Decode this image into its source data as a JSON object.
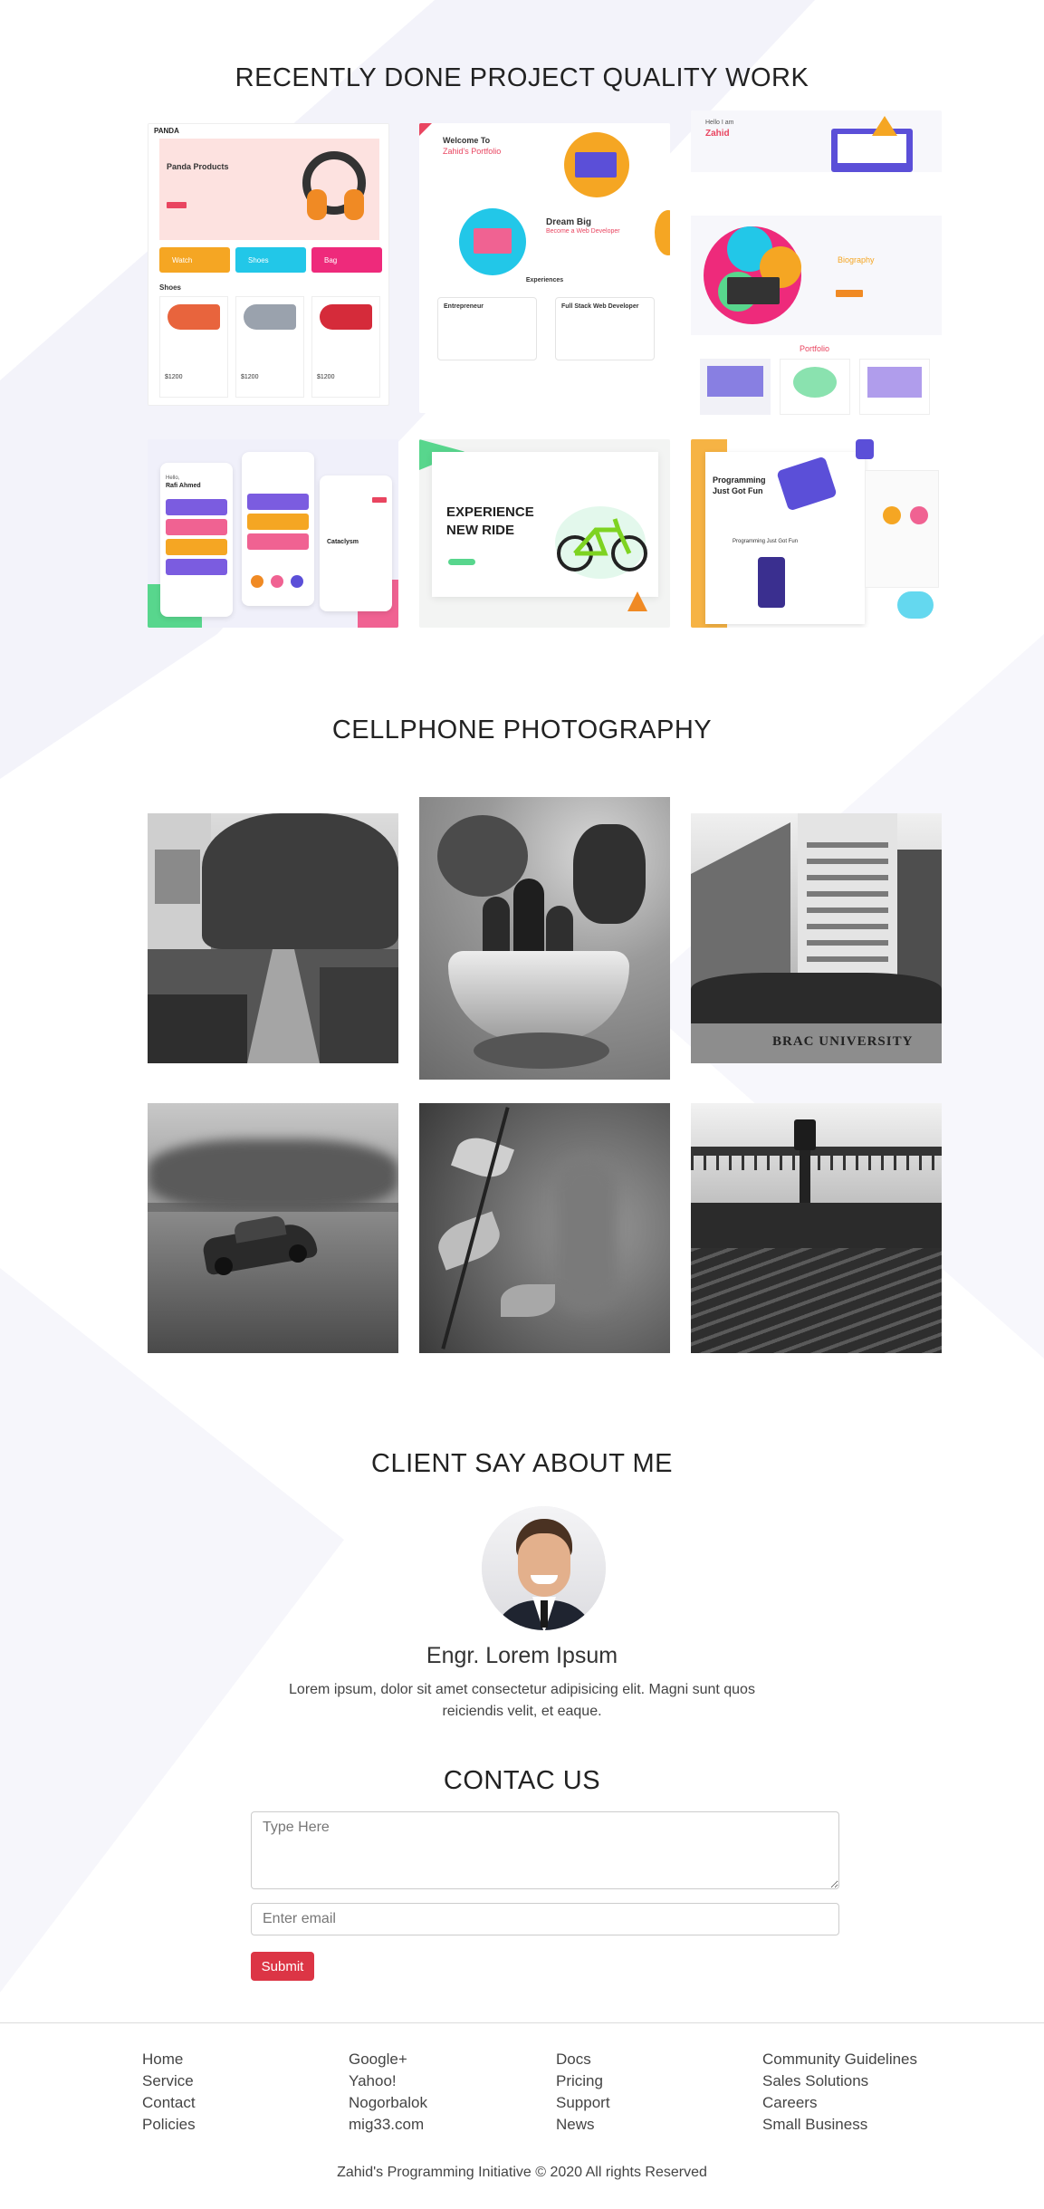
{
  "sections": {
    "projects_title": "RECENTLY DONE PROJECT QUALITY WORK",
    "photography_title": "CELLPHONE PHOTOGRAPHY",
    "client_title": "CLIENT SAY ABOUT ME",
    "contact_title": "CONTAC US"
  },
  "projects": [
    {
      "title": "Panda Products",
      "brand": "PANDA",
      "tiles": [
        "Watch",
        "Shoes",
        "Bag"
      ],
      "section": "Shoes",
      "price": "$1200"
    },
    {
      "title": "Welcome To",
      "subtitle": "Zahid's Portfolio",
      "heading": "Dream Big",
      "sub": "Become a Web Developer",
      "exp": "Experiences",
      "left": "Entrepreneur",
      "right": "Full Stack Web Developer"
    },
    {
      "greeting": "Hello I am",
      "name": "Zahid",
      "bio": "Biography",
      "portfolio": "Portfolio"
    },
    {
      "greeting": "Hello,",
      "name": "Rafi Ahmed",
      "screen": "Cataclysm"
    },
    {
      "line1": "EXPERIENCE",
      "line2": "NEW RIDE"
    },
    {
      "title": "Programming",
      "sub": "Just Got Fun",
      "label": "Programming Just Got Fun"
    }
  ],
  "testimonial": {
    "name": "Engr. Lorem Ipsum",
    "text": "Lorem ipsum, dolor sit amet consectetur adipisicing elit. Magni sunt quos reiciendis velit, et eaque."
  },
  "contact": {
    "message_placeholder": "Type Here",
    "email_placeholder": "Enter email",
    "submit_label": "Submit"
  },
  "footer": {
    "columns": [
      [
        "Home",
        "Service",
        "Contact",
        "Policies"
      ],
      [
        "Google+",
        "Yahoo!",
        "Nogorbalok",
        "mig33.com"
      ],
      [
        "Docs",
        "Pricing",
        "Support",
        "News"
      ],
      [
        "Community Guidelines",
        "Sales Solutions",
        "Careers",
        "Small Business"
      ]
    ],
    "copyright": "Zahid's Programming Initiative © 2020 All rights Reserved"
  },
  "photo_caption": "BRAC UNIVERSITY",
  "colors": {
    "accent_red": "#dc3545",
    "pink": "#f06292",
    "orange": "#f5a623",
    "cyan": "#22c7e8",
    "magenta": "#ee2a7b",
    "purple": "#5b4fd8",
    "green": "#58d68d"
  }
}
